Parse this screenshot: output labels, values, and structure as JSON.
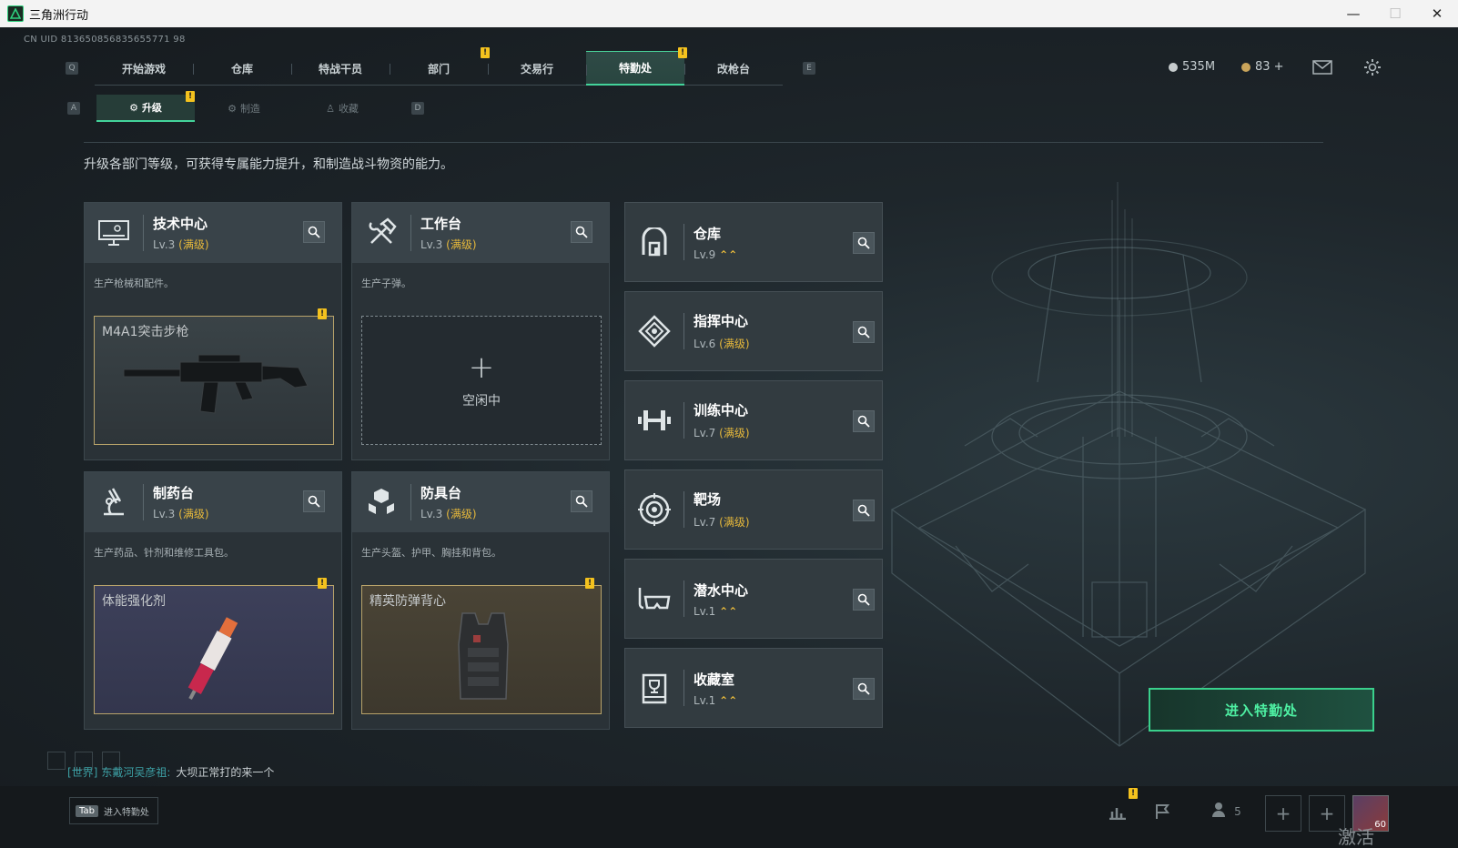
{
  "window": {
    "title": "三角洲行动",
    "minimize": "—",
    "maximize": "☐",
    "close": "✕"
  },
  "uid": "CN UID 813650856835655771 98",
  "top_nav": {
    "key_left": "Q",
    "key_right": "E",
    "tabs": [
      {
        "label": "开始游戏"
      },
      {
        "label": "仓库"
      },
      {
        "label": "特战干员"
      },
      {
        "label": "部门"
      },
      {
        "label": "交易行"
      },
      {
        "label": "特勤处"
      },
      {
        "label": "改枪台"
      }
    ],
    "active_index": 5
  },
  "currency": {
    "money": "535M",
    "coins": "83 +"
  },
  "sub_nav": {
    "key_left": "A",
    "key_right": "D",
    "tabs": [
      {
        "label": "升级"
      },
      {
        "label": "制造"
      },
      {
        "label": "收藏"
      }
    ]
  },
  "description": "升级各部门等级，可获得专属能力提升，和制造战斗物资的能力。",
  "badge": "!",
  "cards": [
    {
      "name": "技术中心",
      "level": "Lv.3",
      "max": "(满级)",
      "desc": "生产枪械和配件。",
      "slot": "M4A1突击步枪",
      "icon": "monitor-icon"
    },
    {
      "name": "工作台",
      "level": "Lv.3",
      "max": "(满级)",
      "desc": "生产子弹。",
      "slot_empty_plus": "+",
      "slot_empty": "空闲中",
      "icon": "hammer-wrench-icon"
    },
    {
      "name": "制药台",
      "level": "Lv.3",
      "max": "(满级)",
      "desc": "生产药品、针剂和维修工具包。",
      "slot": "体能强化剂",
      "icon": "microscope-icon"
    },
    {
      "name": "防具台",
      "level": "Lv.3",
      "max": "(满级)",
      "desc": "生产头盔、护甲、胸挂和背包。",
      "slot": "精英防弹背心",
      "icon": "cubes-icon"
    }
  ],
  "small_cards": [
    {
      "name": "仓库",
      "level": "Lv.9",
      "upgrade": "⌃⌃",
      "icon": "warehouse-icon"
    },
    {
      "name": "指挥中心",
      "level": "Lv.6",
      "max": "(满级)",
      "icon": "command-icon"
    },
    {
      "name": "训练中心",
      "level": "Lv.7",
      "max": "(满级)",
      "icon": "dumbbell-icon"
    },
    {
      "name": "靶场",
      "level": "Lv.7",
      "max": "(满级)",
      "icon": "target-icon"
    },
    {
      "name": "潜水中心",
      "level": "Lv.1",
      "upgrade": "⌃⌃",
      "icon": "diving-mask-icon"
    },
    {
      "name": "收藏室",
      "level": "Lv.1",
      "upgrade": "⌃⌃",
      "icon": "trophy-case-icon"
    }
  ],
  "enter_button": "进入特勤处",
  "chat": {
    "channel": "[世界]",
    "user": "东戴河吴彦祖:",
    "message": "大坝正常打的来一个"
  },
  "bottom": {
    "tab_key": "Tab",
    "tab_label": "进入特勤处",
    "friends": "5",
    "avatar_level": "60"
  },
  "watermark": "激活 Windows",
  "colors": {
    "accent": "#43d39a",
    "max_level": "#e7b93b",
    "badge": "#f4c21e"
  }
}
